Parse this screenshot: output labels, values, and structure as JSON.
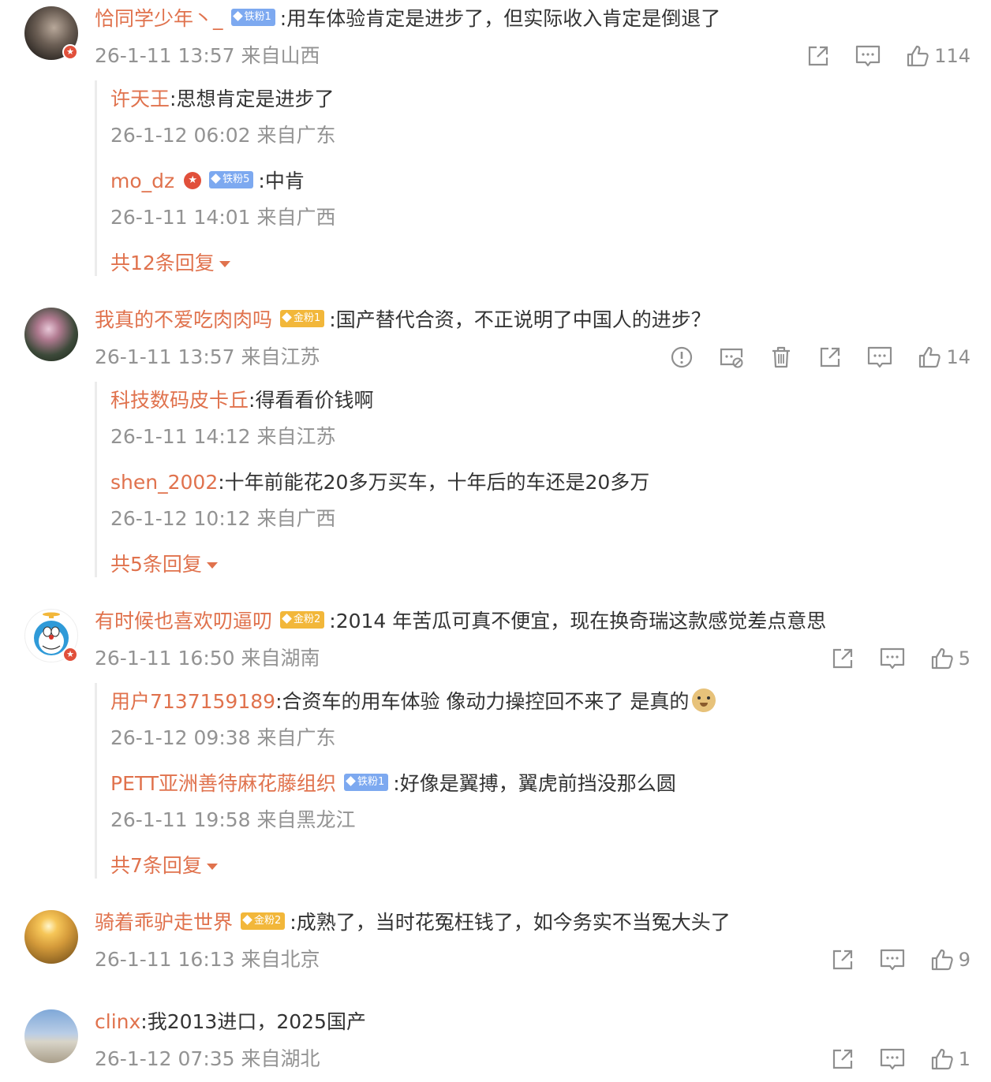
{
  "comments": [
    {
      "user": "恰同学少年丶_",
      "fan_badge": "铁粉1",
      "text": ":用车体验肯定是进步了，但实际收入肯定是倒退了",
      "meta": "26-1-11 13:57 来自山西",
      "likes": "114",
      "replies": [
        {
          "user": "许天王",
          "text": ":思想肯定是进步了",
          "meta": "26-1-12 06:02 来自广东"
        },
        {
          "user": "mo_dz",
          "fan_badge": "铁粉5",
          "text": ":中肯",
          "meta": "26-1-11 14:01 来自广西"
        }
      ],
      "more": "共12条回复"
    },
    {
      "user": "我真的不爱吃肉肉吗",
      "fan_badge": "金粉1",
      "text": ":国产替代合资，不正说明了中国人的进步？",
      "meta": "26-1-11 13:57 来自江苏",
      "likes": "14",
      "replies": [
        {
          "user": "科技数码皮卡丘",
          "text": ":得看看价钱啊",
          "meta": "26-1-11 14:12 来自江苏"
        },
        {
          "user": "shen_2002",
          "text": ":十年前能花20多万买车，十年后的车还是20多万",
          "meta": "26-1-12 10:12 来自广西"
        }
      ],
      "more": "共5条回复"
    },
    {
      "user": "有时候也喜欢叨逼叨",
      "fan_badge": "金粉2",
      "text": ":2014 年苦瓜可真不便宜，现在换奇瑞这款感觉差点意思",
      "meta": "26-1-11 16:50 来自湖南",
      "likes": "5",
      "replies": [
        {
          "user": "用户7137159189",
          "text": ":合资车的用车体验 像动力操控回不来了 是真的",
          "meta": "26-1-12 09:38 来自广东"
        },
        {
          "user": "PETT亚洲善待麻花藤组织",
          "fan_badge": "铁粉1",
          "text": ":好像是翼搏，翼虎前挡没那么圆",
          "meta": "26-1-11 19:58 来自黑龙江"
        }
      ],
      "more": "共7条回复"
    },
    {
      "user": "骑着乖驴走世界",
      "fan_badge": "金粉2",
      "text": ":成熟了，当时花冤枉钱了，如今务实不当冤大头了",
      "meta": "26-1-11 16:13 来自北京",
      "likes": "9"
    },
    {
      "user": "clinx",
      "text": ":我2013进口，2025国产",
      "meta": "26-1-12 07:35 来自湖北",
      "likes": "1"
    }
  ],
  "icons": {
    "share": "share-icon",
    "comment": "comment-icon",
    "like": "like-icon",
    "report": "report-icon",
    "hide": "hide-icon",
    "delete": "delete-icon",
    "verified": "verified-badge-icon",
    "doge": "doge-emoji-icon"
  },
  "colors": {
    "name": "#e0724d",
    "meta": "#939393",
    "text": "#333333",
    "iron_badge": "#7da9f0",
    "gold_badge": "#f2b73a"
  }
}
